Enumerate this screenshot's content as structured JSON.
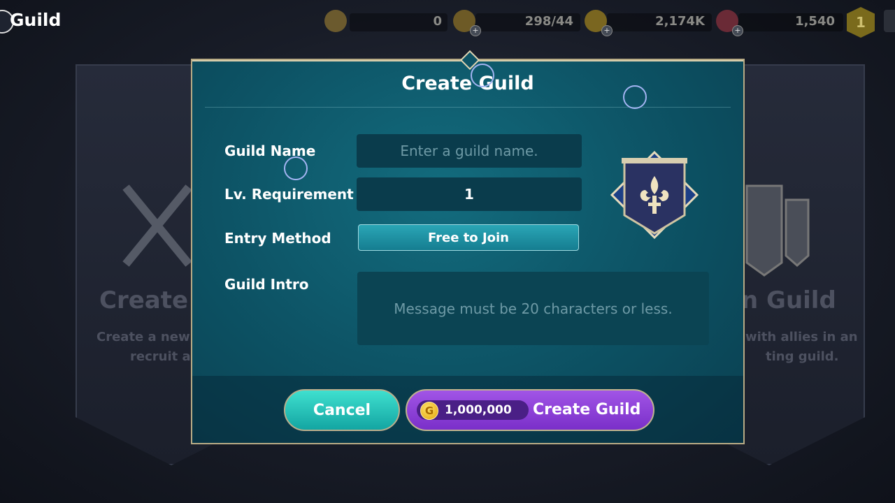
{
  "screen": {
    "title": "Guild"
  },
  "resources": [
    {
      "icon": "token-icon",
      "value": "0"
    },
    {
      "icon": "stamina-icon",
      "value": "298/44"
    },
    {
      "icon": "gold-coin-icon",
      "value": "2,174K"
    },
    {
      "icon": "ruby-gem-icon",
      "value": "1,540"
    }
  ],
  "rank_badge": "1",
  "background": {
    "left_title": "Create G",
    "left_desc_1": "Create a new g",
    "left_desc_2": "recruit all",
    "right_title": "n Guild",
    "right_desc_1": "with allies in an",
    "right_desc_2": "ting guild."
  },
  "modal": {
    "title": "Create Guild",
    "fields": {
      "guild_name_label": "Guild Name",
      "guild_name_placeholder": "Enter a guild name.",
      "level_label": "Lv. Requirement",
      "level_value": "1",
      "entry_label": "Entry Method",
      "entry_value": "Free to Join",
      "intro_label": "Guild Intro",
      "intro_placeholder": "Message must be 20 characters or less."
    },
    "buttons": {
      "cancel": "Cancel",
      "create_cost": "1,000,000",
      "create": "Create Guild"
    }
  },
  "colors": {
    "accent_teal": "#13a5a2",
    "accent_purple": "#7a2fc9",
    "gold_border": "#b8ab85"
  }
}
